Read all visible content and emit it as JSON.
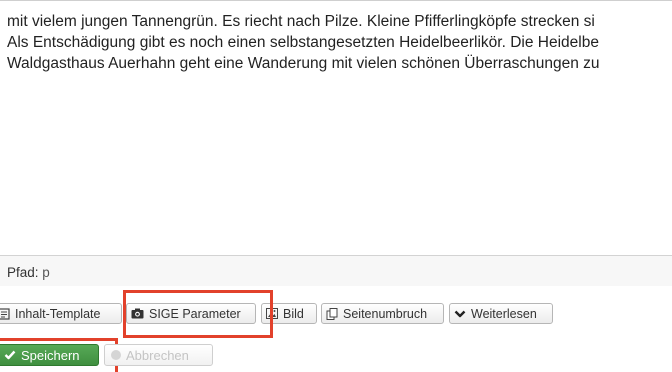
{
  "editor": {
    "lines": [
      "mit vielem jungen Tannengrün. Es riecht nach Pilze. Kleine Pfifferlingköpfe strecken si",
      "Als Entschädigung gibt es noch einen selbstangesetzten Heidelbeerlikör. Die Heidelbe",
      "Waldgasthaus Auerhahn geht eine Wanderung mit vielen schönen Überraschungen zu"
    ],
    "path_label": "Pfad:",
    "path_value": "p"
  },
  "toolbar": {
    "buttons": [
      {
        "label": "Inhalt-Template",
        "icon": "template-icon"
      },
      {
        "label": "SIGE Parameter",
        "icon": "camera-icon"
      },
      {
        "label": "Bild",
        "icon": "image-icon"
      },
      {
        "label": "Seitenumbruch",
        "icon": "pagebreak-icon"
      },
      {
        "label": "Weiterlesen",
        "icon": "chevron-down-icon"
      }
    ]
  },
  "actions": {
    "save_label": "Speichern",
    "cancel_label": "Abbrechen"
  },
  "colors": {
    "highlight": "#e2412b",
    "save_green": "#3f8f3f"
  }
}
